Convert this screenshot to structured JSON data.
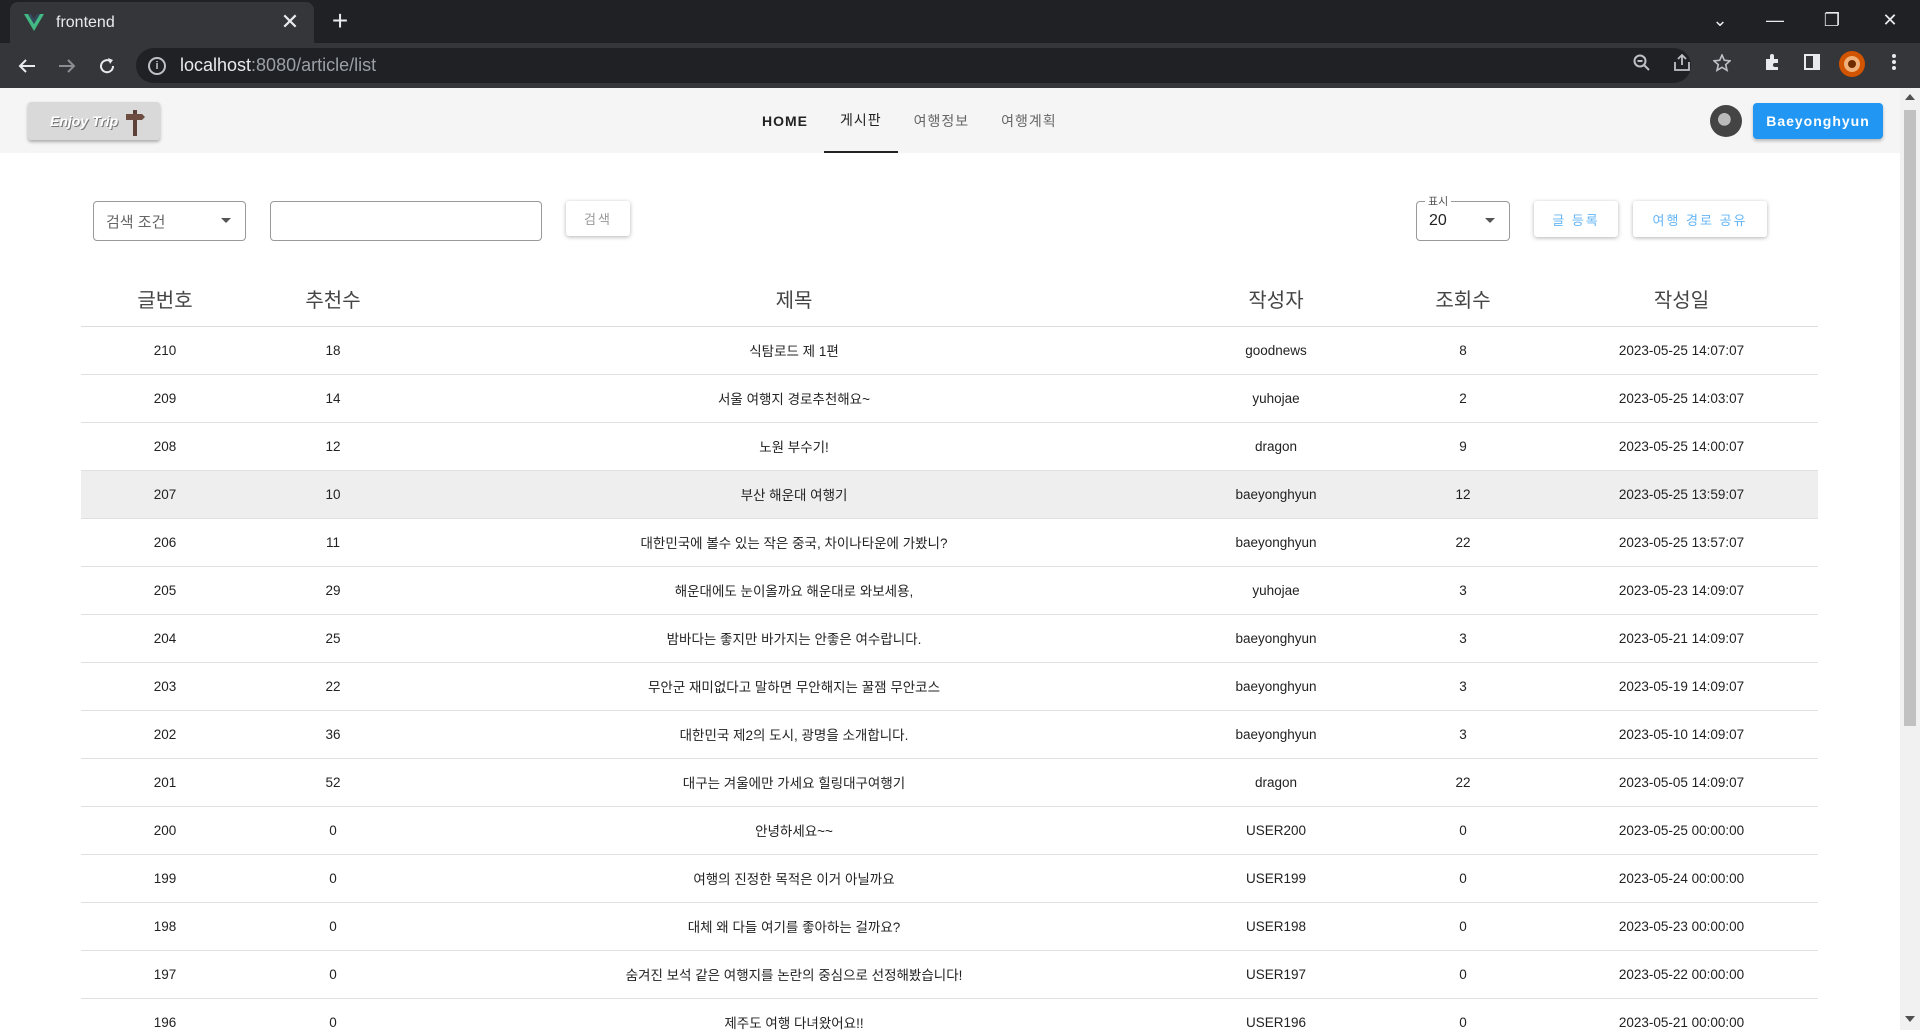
{
  "browser": {
    "tab_title": "frontend",
    "tab_close": "✕",
    "new_tab": "+",
    "url_host": "localhost",
    "url_path": ":8080/article/list",
    "win_min": "—",
    "win_restore": "❐",
    "win_close": "✕",
    "dropdown": "⌄",
    "favicon_color": "#42b883"
  },
  "header": {
    "logo_text": "Enjoy Trip",
    "nav": [
      {
        "label": "HOME"
      },
      {
        "label": "게시판"
      },
      {
        "label": "여행정보"
      },
      {
        "label": "여행계획"
      }
    ],
    "user_button": "Baeyonghyun",
    "accent_color": "#2196f3"
  },
  "controls": {
    "search_condition": "검색 조건",
    "search_button": "검색",
    "display_label": "표시",
    "display_value": "20",
    "write_button": "글 등록",
    "share_button": "여행 경로 공유"
  },
  "table": {
    "headers": [
      "글번호",
      "추천수",
      "제목",
      "작성자",
      "조회수",
      "작성일"
    ],
    "rows": [
      [
        "210",
        "18",
        "식탐로드 제 1편",
        "goodnews",
        "8",
        "2023-05-25 14:07:07"
      ],
      [
        "209",
        "14",
        "서울 여행지 경로추천해요~",
        "yuhojae",
        "2",
        "2023-05-25 14:03:07"
      ],
      [
        "208",
        "12",
        "노원 부수기!",
        "dragon",
        "9",
        "2023-05-25 14:00:07"
      ],
      [
        "207",
        "10",
        "부산 해운대 여행기",
        "baeyonghyun",
        "12",
        "2023-05-25 13:59:07"
      ],
      [
        "206",
        "11",
        "대한민국에 볼수 있는 작은 중국, 차이나타운에 가봤니?",
        "baeyonghyun",
        "22",
        "2023-05-25 13:57:07"
      ],
      [
        "205",
        "29",
        "해운대에도 눈이올까요 해운대로 와보세용,",
        "yuhojae",
        "3",
        "2023-05-23 14:09:07"
      ],
      [
        "204",
        "25",
        "밤바다는 좋지만 바가지는 안좋은 여수랍니다.",
        "baeyonghyun",
        "3",
        "2023-05-21 14:09:07"
      ],
      [
        "203",
        "22",
        "무안군 재미없다고 말하면 무안해지는 꿀잼 무안코스",
        "baeyonghyun",
        "3",
        "2023-05-19 14:09:07"
      ],
      [
        "202",
        "36",
        "대한민국 제2의 도시, 광명을 소개합니다.",
        "baeyonghyun",
        "3",
        "2023-05-10 14:09:07"
      ],
      [
        "201",
        "52",
        "대구는 겨울에만 가세요 힐링대구여행기",
        "dragon",
        "22",
        "2023-05-05 14:09:07"
      ],
      [
        "200",
        "0",
        "안녕하세요~~",
        "USER200",
        "0",
        "2023-05-25 00:00:00"
      ],
      [
        "199",
        "0",
        "여행의 진정한 목적은 이거 아닐까요",
        "USER199",
        "0",
        "2023-05-24 00:00:00"
      ],
      [
        "198",
        "0",
        "대체 왜 다들 여기를 좋아하는 걸까요?",
        "USER198",
        "0",
        "2023-05-23 00:00:00"
      ],
      [
        "197",
        "0",
        "숨겨진 보석 같은 여행지를 논란의 중심으로 선정해봤습니다!",
        "USER197",
        "0",
        "2023-05-22 00:00:00"
      ],
      [
        "196",
        "0",
        "제주도 여행 다녀왔어요!!",
        "USER196",
        "0",
        "2023-05-21 00:00:00"
      ]
    ],
    "highlighted_row": 3
  }
}
